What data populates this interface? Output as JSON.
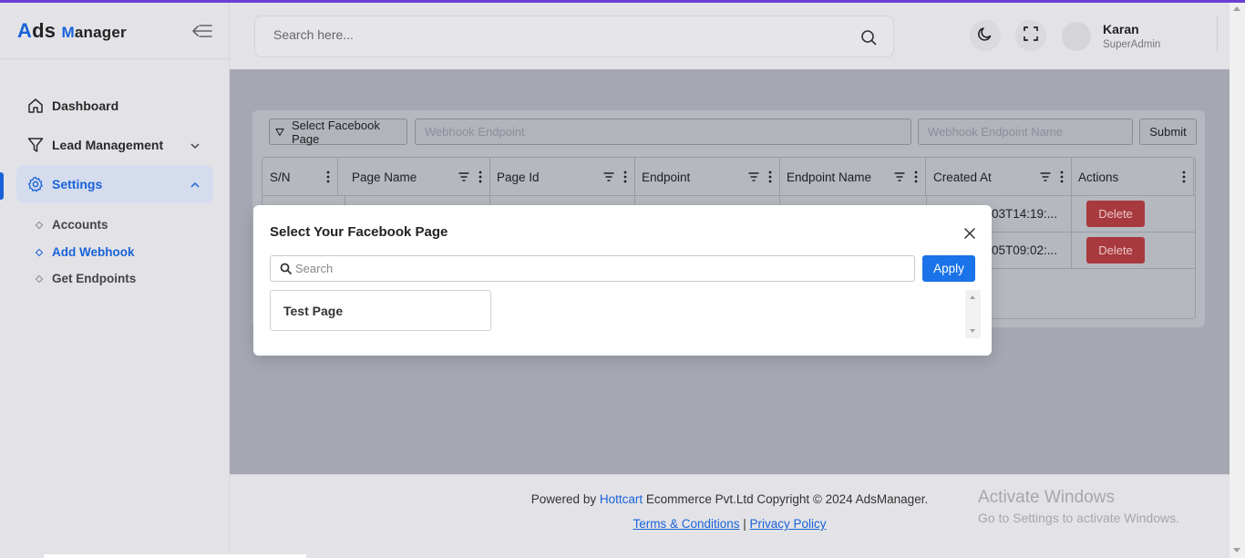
{
  "app": {
    "logo_part1": "A",
    "logo_part2": "ds ",
    "logo_part3": "M",
    "logo_part4": "anager"
  },
  "sidebar": {
    "items": [
      {
        "label": "Dashboard",
        "icon": "home-icon"
      },
      {
        "label": "Lead Management",
        "icon": "filter-icon"
      },
      {
        "label": "Settings",
        "icon": "gear-icon"
      }
    ],
    "sub_items": [
      {
        "label": "Accounts"
      },
      {
        "label": "Add Webhook"
      },
      {
        "label": "Get Endpoints"
      }
    ]
  },
  "header": {
    "search_placeholder": "Search here...",
    "user_name": "Karan",
    "user_role": "SuperAdmin"
  },
  "form": {
    "select_page_label": "Select Facebook Page",
    "endpoint_placeholder": "Webhook Endpoint",
    "endpoint_name_placeholder": "Webhook Endpoint Name",
    "submit_label": "Submit"
  },
  "table": {
    "columns": [
      "S/N",
      "Page Name",
      "Page Id",
      "Endpoint",
      "Endpoint Name",
      "Created At",
      "Actions"
    ],
    "rows": [
      {
        "created_at": "03T14:19:...",
        "action": "Delete"
      },
      {
        "created_at": "05T09:02:...",
        "action": "Delete"
      }
    ]
  },
  "modal": {
    "title": "Select Your Facebook Page",
    "search_placeholder": "Search",
    "apply_label": "Apply",
    "options": [
      "Test Page"
    ]
  },
  "footer": {
    "powered_prefix": "Powered by ",
    "powered_link": "Hottcart",
    "powered_suffix": " Ecommerce Pvt.Ltd Copyright © 2024 AdsManager.",
    "terms": "Terms & Conditions",
    "separator": "|",
    "privacy": "Privacy Policy"
  },
  "watermark": {
    "title": "Activate Windows",
    "subtitle": "Go to Settings to activate Windows."
  },
  "colors": {
    "accent": "#1a62d9",
    "apply": "#1a73e8",
    "delete": "#a8393f",
    "top_accent": "#6b3fd6"
  }
}
